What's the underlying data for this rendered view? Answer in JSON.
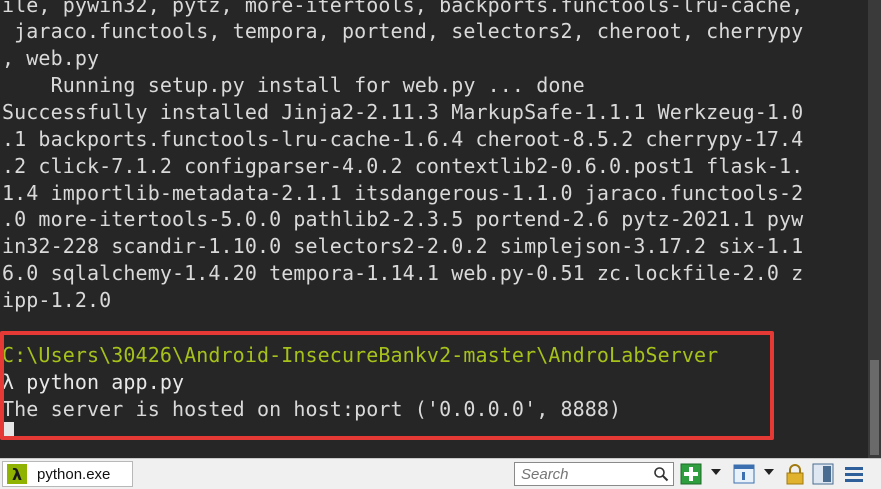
{
  "terminal": {
    "lines": [
      "ile, pywin32, pytz, more-itertools, backports.functools-lru-cache,",
      " jaraco.functools, tempora, portend, selectors2, cheroot, cherrypy",
      ", web.py",
      "    Running setup.py install for web.py ... done",
      "Successfully installed Jinja2-2.11.3 MarkupSafe-1.1.1 Werkzeug-1.0",
      ".1 backports.functools-lru-cache-1.6.4 cheroot-8.5.2 cherrypy-17.4",
      ".2 click-7.1.2 configparser-4.0.2 contextlib2-0.6.0.post1 flask-1.",
      "1.4 importlib-metadata-2.1.1 itsdangerous-1.1.0 jaraco.functools-2",
      ".0 more-itertools-5.0.0 pathlib2-2.3.5 portend-2.6 pytz-2021.1 pyw",
      "in32-228 scandir-1.10.0 selectors2-2.0.2 simplejson-3.17.2 six-1.1",
      "6.0 sqlalchemy-1.4.20 tempora-1.14.1 web.py-0.51 zc.lockfile-2.0 z",
      "ipp-1.2.0"
    ],
    "path": "C:\\Users\\30426\\Android-InsecureBankv2-master\\AndroLabServer",
    "command": "λ python app.py",
    "output": "The server is hosted on host:port ('0.0.0.0', 8888)"
  },
  "taskbar": {
    "tab_icon": "λ",
    "tab_label": "python.exe",
    "search_placeholder": "Search"
  },
  "icons": [
    "lambda-icon",
    "search-icon",
    "add-tab-icon",
    "console-icon",
    "lock-icon",
    "split-view-icon",
    "menu-icon"
  ],
  "colors": {
    "terminal_bg": "#262626",
    "path": "#a6c21a",
    "highlight": "#e53935"
  }
}
